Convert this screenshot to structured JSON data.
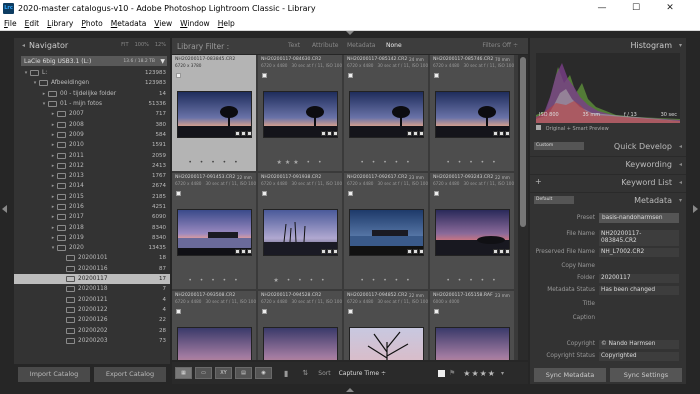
{
  "window": {
    "app_icon": "Lrc",
    "title": "2020-master catalogus-v10 - Adobe Photoshop Lightroom Classic - Library",
    "controls": {
      "minimize": "—",
      "maximize": "☐",
      "close": "✕"
    }
  },
  "menu": [
    "File",
    "Edit",
    "Library",
    "Photo",
    "Metadata",
    "View",
    "Window",
    "Help"
  ],
  "navigator": {
    "title": "Navigator",
    "zoom_options": [
      "FIT",
      "100%",
      "12%"
    ],
    "volume": {
      "name": "LaCie 6big USB3.1 (L:)",
      "size": "13.6 / 18.2 TB"
    }
  },
  "folders": [
    {
      "label": "L:",
      "count": "123983",
      "depth": 0,
      "twist": "▾"
    },
    {
      "label": "Afbeeldingen",
      "count": "123983",
      "depth": 1,
      "twist": "▾"
    },
    {
      "label": "00 - tijdelijke folder",
      "count": "14",
      "depth": 2,
      "twist": "▸"
    },
    {
      "label": "01 - mijn fotos",
      "count": "51336",
      "depth": 2,
      "twist": "▾"
    },
    {
      "label": "2007",
      "count": "717",
      "depth": 3,
      "twist": "▸"
    },
    {
      "label": "2008",
      "count": "380",
      "depth": 3,
      "twist": "▸"
    },
    {
      "label": "2009",
      "count": "584",
      "depth": 3,
      "twist": "▸"
    },
    {
      "label": "2010",
      "count": "1591",
      "depth": 3,
      "twist": "▸"
    },
    {
      "label": "2011",
      "count": "2059",
      "depth": 3,
      "twist": "▸"
    },
    {
      "label": "2012",
      "count": "2413",
      "depth": 3,
      "twist": "▸"
    },
    {
      "label": "2013",
      "count": "1767",
      "depth": 3,
      "twist": "▸"
    },
    {
      "label": "2014",
      "count": "2674",
      "depth": 3,
      "twist": "▸"
    },
    {
      "label": "2015",
      "count": "2185",
      "depth": 3,
      "twist": "▸"
    },
    {
      "label": "2016",
      "count": "4251",
      "depth": 3,
      "twist": "▸"
    },
    {
      "label": "2017",
      "count": "6090",
      "depth": 3,
      "twist": "▸"
    },
    {
      "label": "2018",
      "count": "8340",
      "depth": 3,
      "twist": "▸"
    },
    {
      "label": "2019",
      "count": "8340",
      "depth": 3,
      "twist": "▸"
    },
    {
      "label": "2020",
      "count": "13435",
      "depth": 3,
      "twist": "▾"
    },
    {
      "label": "20200101",
      "count": "18",
      "depth": 4,
      "twist": ""
    },
    {
      "label": "20200116",
      "count": "87",
      "depth": 4,
      "twist": ""
    },
    {
      "label": "20200117",
      "count": "17",
      "depth": 4,
      "twist": "",
      "selected": true
    },
    {
      "label": "20200118",
      "count": "7",
      "depth": 4,
      "twist": ""
    },
    {
      "label": "20200121",
      "count": "4",
      "depth": 4,
      "twist": ""
    },
    {
      "label": "20200122",
      "count": "4",
      "depth": 4,
      "twist": ""
    },
    {
      "label": "20200126",
      "count": "22",
      "depth": 4,
      "twist": ""
    },
    {
      "label": "20200202",
      "count": "28",
      "depth": 4,
      "twist": ""
    },
    {
      "label": "20200203",
      "count": "73",
      "depth": 4,
      "twist": ""
    }
  ],
  "left_buttons": {
    "import": "Import Catalog",
    "export": "Export Catalog"
  },
  "library_filter": {
    "title": "Library Filter :",
    "tabs": [
      "Text",
      "Attribute",
      "Metadata",
      "None"
    ],
    "active": "None",
    "filters_off": "Filters Off ÷"
  },
  "photos": [
    {
      "name": "NH20200117-083845.CR2",
      "dims": "6720 x 3780",
      "exif": "",
      "stars": "• • • • •",
      "scene": "tree",
      "selected": true
    },
    {
      "name": "NH20200117-084630.CR2",
      "dims": "6720 x 4480",
      "exif": "30 sec at f / 11, ISO 100",
      "stars": "★★★ • •",
      "scene": "tree"
    },
    {
      "name": "NH20200117-085142.CR2",
      "dims": "6720 x 4480",
      "exif": "30 sec at f / 11, ISO 100",
      "focal": "24 mm",
      "stars": "• • • • •",
      "scene": "tree"
    },
    {
      "name": "NH20200117-085746.CR2",
      "dims": "6720 x 4480",
      "exif": "30 sec at f / 11, ISO 100",
      "focal": "70 mm",
      "stars": "• • • • •",
      "scene": "tree"
    },
    {
      "name": "NH20200117-091453.CR2",
      "dims": "6720 x 4480",
      "exif": "30 sec at f / 11, ISO 100",
      "focal": "22 mm",
      "stars": "• • • • •",
      "scene": "lake"
    },
    {
      "name": "NH20200117-091938.CR2",
      "dims": "6720 x 4480",
      "exif": "30 sec at f / 11, ISO 100",
      "focal": "",
      "stars": "★ • • • •",
      "scene": "reeds"
    },
    {
      "name": "NH20200117-092617.CR2",
      "dims": "6720 x 4480",
      "exif": "30 sec at f / 11, ISO 100",
      "focal": "23 mm",
      "stars": "• • • • •",
      "scene": "blue"
    },
    {
      "name": "NH20200117-093243.CR2",
      "dims": "6720 x 4480",
      "exif": "30 sec at f / 11, ISO 100",
      "focal": "22 mm",
      "stars": "• • • • •",
      "scene": "marsh"
    },
    {
      "name": "NH20200117-093508.CR2",
      "dims": "6720 x 4480",
      "exif": "30 sec at f / 11, ISO 100",
      "focal": "",
      "stars": "",
      "scene": "dusk"
    },
    {
      "name": "NH20200117-094528.CR2",
      "dims": "6720 x 4480",
      "exif": "30 sec at f / 11, ISO 100",
      "focal": "",
      "stars": "",
      "scene": "dusk"
    },
    {
      "name": "NH20200117-094852.CR2",
      "dims": "6720 x 4480",
      "exif": "30 sec at f / 11, ISO 100",
      "focal": "22 mm",
      "stars": "",
      "scene": "branches"
    },
    {
      "name": "NH20200117-165158.RAF",
      "dims": "6000 x 4000",
      "exif": "",
      "focal": "23 mm",
      "stars": "",
      "scene": "dusk"
    }
  ],
  "toolbar": {
    "sort_label": "Sort",
    "sort_value": "Capture Time ÷",
    "rating": "★★★★"
  },
  "histogram": {
    "title": "Histogram",
    "iso": "ISO 800",
    "focal": "35 mm",
    "aperture": "f / 13",
    "shutter": "30 sec",
    "preview_note": "Original + Smart Preview"
  },
  "sections": {
    "quick_develop": "Quick Develop",
    "keywording": "Keywording",
    "keyword_list": "Keyword List",
    "metadata": "Metadata",
    "saved_preset": "Custom",
    "meta_mode": "Default"
  },
  "metadata": {
    "preset_label": "Preset",
    "preset_value": "basis-nandoharmsen",
    "rows": [
      {
        "label": "File Name",
        "value": "NH20200117-083845.CR2"
      },
      {
        "label": "Preserved File Name",
        "value": "NH_L7002.CR2"
      },
      {
        "label": "Copy Name",
        "value": ""
      },
      {
        "label": "Folder",
        "value": "20200117"
      },
      {
        "label": "Metadata Status",
        "value": "Has been changed"
      },
      {
        "label": "Title",
        "value": ""
      },
      {
        "label": "Caption",
        "value": ""
      },
      {
        "label": "Copyright",
        "value": "© Nando Harmsen"
      },
      {
        "label": "Copyright Status",
        "value": "Copyrighted"
      }
    ]
  },
  "right_buttons": {
    "sync_metadata": "Sync Metadata",
    "sync_settings": "Sync Settings"
  }
}
